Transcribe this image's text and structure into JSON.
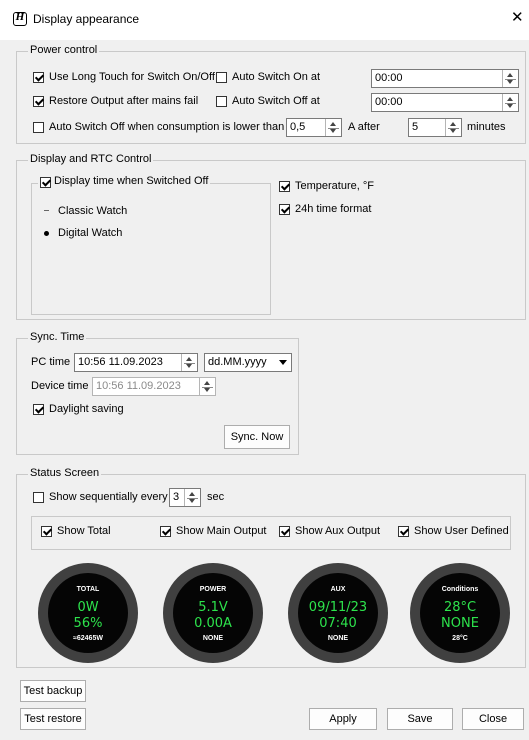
{
  "window": {
    "title": "Display appearance",
    "app_icon": "H"
  },
  "power": {
    "legend": "Power control",
    "long_touch": {
      "label": "Use Long Touch for Switch On/Off",
      "checked": true
    },
    "auto_on": {
      "label": "Auto Switch On at",
      "checked": false,
      "time": "00:00"
    },
    "restore": {
      "label": "Restore Output after mains fail",
      "checked": true
    },
    "auto_off": {
      "label": "Auto Switch Off at",
      "checked": false,
      "time": "00:00"
    },
    "low_consumption": {
      "label": "Auto Switch Off when consumption is lower than",
      "checked": false,
      "amps": "0,5",
      "amps_unit": "A after",
      "minutes": "5",
      "minutes_unit": "minutes"
    }
  },
  "rtc": {
    "legend": "Display and RTC Control",
    "display_time": {
      "label": "Display time when Switched Off",
      "checked": true
    },
    "classic": {
      "label": "Classic Watch",
      "selected": false
    },
    "digital": {
      "label": "Digital Watch",
      "selected": true
    },
    "temperature": {
      "label": "Temperature, °F",
      "checked": true
    },
    "time24": {
      "label": "24h time format",
      "checked": true
    }
  },
  "sync": {
    "legend": "Sync. Time",
    "pc_time_label": "PC time",
    "pc_time": "10:56 11.09.2023",
    "format": "dd.MM.yyyy",
    "device_time_label": "Device time",
    "device_time": "10:56 11.09.2023",
    "daylight": {
      "label": "Daylight saving",
      "checked": true
    },
    "sync_button": "Sync. Now"
  },
  "status": {
    "legend": "Status Screen",
    "sequential": {
      "label": "Show sequentially every",
      "checked": false,
      "value": "3",
      "unit": "sec"
    },
    "show_total": {
      "label": "Show Total",
      "checked": true
    },
    "show_main": {
      "label": "Show Main Output",
      "checked": true
    },
    "show_aux": {
      "label": "Show Aux Output",
      "checked": true
    },
    "show_user": {
      "label": "Show User Defined",
      "checked": true
    },
    "gauges": [
      {
        "head": "TOTAL",
        "line1": "0W",
        "line2": "56%",
        "foot": "≈62465W"
      },
      {
        "head": "POWER",
        "line1": "5.1V",
        "line2": "0.00A",
        "foot": "NONE"
      },
      {
        "head": "AUX",
        "line1": "09/11/23",
        "line2": "07:40",
        "foot": "NONE"
      },
      {
        "head": "Conditions",
        "line1": "28°C",
        "line2": "NONE",
        "foot": "28°C"
      }
    ],
    "value_color": "#2de34c"
  },
  "buttons": {
    "test_backup": "Test backup",
    "test_restore": "Test restore",
    "apply": "Apply",
    "save": "Save",
    "close": "Close"
  }
}
